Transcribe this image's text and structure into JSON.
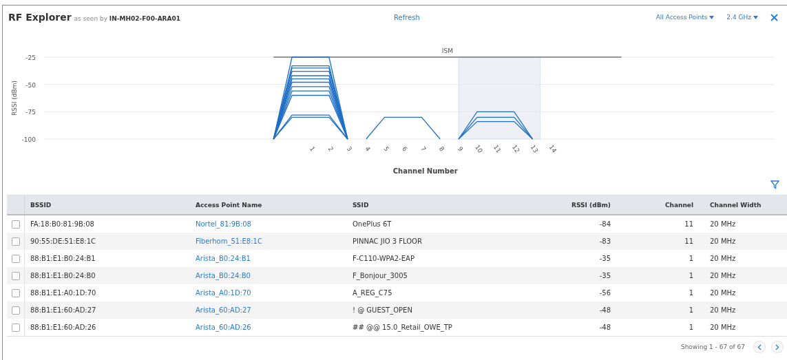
{
  "header": {
    "title": "RF Explorer",
    "subtitle": "as seen by **IN-MH02-F00-ARA01**",
    "refresh": "Refresh",
    "ap_filter": "All Access Points",
    "band_filter": "2.4 GHz"
  },
  "chart_data": {
    "type": "line",
    "xlabel": "Channel Number",
    "ylabel": "RSSI (dBm)",
    "x": [
      -1,
      0,
      1,
      2,
      3,
      4,
      5,
      6,
      7,
      8,
      9,
      10,
      11,
      12,
      13
    ],
    "xlim": [
      -13.4,
      26.3
    ],
    "ylim": [
      -100,
      -25
    ],
    "xticks": [
      1,
      2,
      3,
      4,
      5,
      6,
      7,
      8,
      9,
      10,
      11,
      12,
      13,
      14
    ],
    "yticks": [
      -25,
      -50,
      -75,
      -100
    ],
    "annotations": [
      "ISM"
    ],
    "series": [
      {
        "color": "#1f6fc5",
        "values": [
          -100,
          -25,
          -25,
          -25,
          -100,
          null,
          null,
          null,
          null,
          null,
          null,
          null,
          null,
          null,
          null
        ]
      },
      {
        "color": "#1f6fc5",
        "values": [
          -100,
          -33,
          -33,
          -33,
          -100,
          null,
          null,
          null,
          null,
          null,
          null,
          null,
          null,
          null,
          null
        ]
      },
      {
        "color": "#1f6fc5",
        "values": [
          -100,
          -35,
          -35,
          -35,
          -100,
          null,
          null,
          null,
          null,
          null,
          null,
          null,
          null,
          null,
          null
        ]
      },
      {
        "color": "#1f6fc5",
        "values": [
          -100,
          -38,
          -38,
          -38,
          -100,
          null,
          null,
          null,
          null,
          null,
          null,
          null,
          null,
          null,
          null
        ]
      },
      {
        "color": "#1f6fc5",
        "values": [
          -100,
          -42,
          -42,
          -42,
          -100,
          null,
          null,
          null,
          null,
          null,
          null,
          null,
          null,
          null,
          null
        ]
      },
      {
        "color": "#1f6fc5",
        "values": [
          -100,
          -45,
          -45,
          -45,
          -100,
          null,
          null,
          null,
          null,
          null,
          null,
          null,
          null,
          null,
          null
        ]
      },
      {
        "color": "#1f6fc5",
        "values": [
          -100,
          -48,
          -48,
          -48,
          -100,
          null,
          null,
          null,
          null,
          null,
          null,
          null,
          null,
          null,
          null
        ]
      },
      {
        "color": "#1f6fc5",
        "values": [
          -100,
          -52,
          -52,
          -52,
          -100,
          null,
          null,
          null,
          null,
          null,
          null,
          null,
          null,
          null,
          null
        ]
      },
      {
        "color": "#1f6fc5",
        "values": [
          -100,
          -56,
          -56,
          -56,
          -100,
          null,
          null,
          null,
          null,
          null,
          null,
          null,
          null,
          null,
          null
        ]
      },
      {
        "color": "#1f6fc5",
        "values": [
          -100,
          -60,
          -60,
          -60,
          -100,
          null,
          null,
          null,
          null,
          null,
          null,
          null,
          null,
          null,
          null
        ]
      },
      {
        "color": "#1f6fc5",
        "values": [
          -100,
          -78,
          -78,
          -78,
          -100,
          null,
          null,
          null,
          null,
          null,
          null,
          null,
          null,
          null,
          null
        ]
      },
      {
        "color": "#1f6fc5",
        "values": [
          -100,
          -80,
          -80,
          -80,
          -100,
          null,
          null,
          null,
          null,
          null,
          null,
          null,
          null,
          null,
          null
        ]
      },
      {
        "color": "#1f6fc5",
        "values": [
          null,
          null,
          null,
          null,
          null,
          -100,
          -80,
          -80,
          -80,
          -100,
          null,
          null,
          null,
          null,
          null
        ]
      },
      {
        "color": "#1f6fc5",
        "values": [
          null,
          null,
          null,
          null,
          null,
          null,
          null,
          null,
          null,
          null,
          -100,
          -75,
          -75,
          -75,
          -100
        ]
      },
      {
        "color": "#1f6fc5",
        "values": [
          null,
          null,
          null,
          null,
          null,
          null,
          null,
          null,
          null,
          null,
          -100,
          -80,
          -80,
          -80,
          -100
        ]
      },
      {
        "color": "#1f6fc5",
        "values": [
          null,
          null,
          null,
          null,
          null,
          null,
          null,
          null,
          null,
          null,
          -100,
          -84,
          -84,
          -84,
          -100
        ]
      }
    ]
  },
  "table": {
    "columns": [
      "BSSID",
      "Access Point Name",
      "SSID",
      "RSSI (dBm)",
      "Channel",
      "Channel Width"
    ],
    "rows": [
      {
        "checked": false,
        "bssid": "FA:18:B0:81:9B:08",
        "ap_name": "Nortel_81:9B:08",
        "ssid": "OnePlus 6T",
        "rssi": "-84",
        "channel": "11",
        "width": "20 MHz"
      },
      {
        "checked": false,
        "bssid": "90:55:DE:51:E8:1C",
        "ap_name": "Fiberhom_51:E8:1C",
        "ssid": "PINNAC JIO 3 FLOOR",
        "rssi": "-83",
        "channel": "11",
        "width": "20 MHz"
      },
      {
        "checked": false,
        "bssid": "88:B1:E1:B0:24:B1",
        "ap_name": "Arista_B0:24:B1",
        "ssid": "F-C110-WPA2-EAP",
        "rssi": "-35",
        "channel": "1",
        "width": "20 MHz"
      },
      {
        "checked": false,
        "bssid": "88:B1:E1:B0:24:B0",
        "ap_name": "Arista_B0:24:B0",
        "ssid": "F_Bonjour_3005",
        "rssi": "-35",
        "channel": "1",
        "width": "20 MHz"
      },
      {
        "checked": false,
        "bssid": "88:B1:E1:A0:1D:70",
        "ap_name": "Arista_A0:1D:70",
        "ssid": "A_REG_C75",
        "rssi": "-56",
        "channel": "1",
        "width": "20 MHz"
      },
      {
        "checked": false,
        "bssid": "88:B1:E1:60:AD:27",
        "ap_name": "Arista_60:AD:27",
        "ssid": "! @ GUEST_OPEN",
        "rssi": "-48",
        "channel": "1",
        "width": "20 MHz"
      },
      {
        "checked": false,
        "bssid": "88:B1:E1:60:AD:26",
        "ap_name": "Arista_60:AD:26",
        "ssid": "## @@ 15.0_Retail_OWE_TP",
        "rssi": "-48",
        "channel": "1",
        "width": "20 MHz"
      }
    ]
  },
  "footer": {
    "summary": "Showing 1 - 67 of 67"
  }
}
